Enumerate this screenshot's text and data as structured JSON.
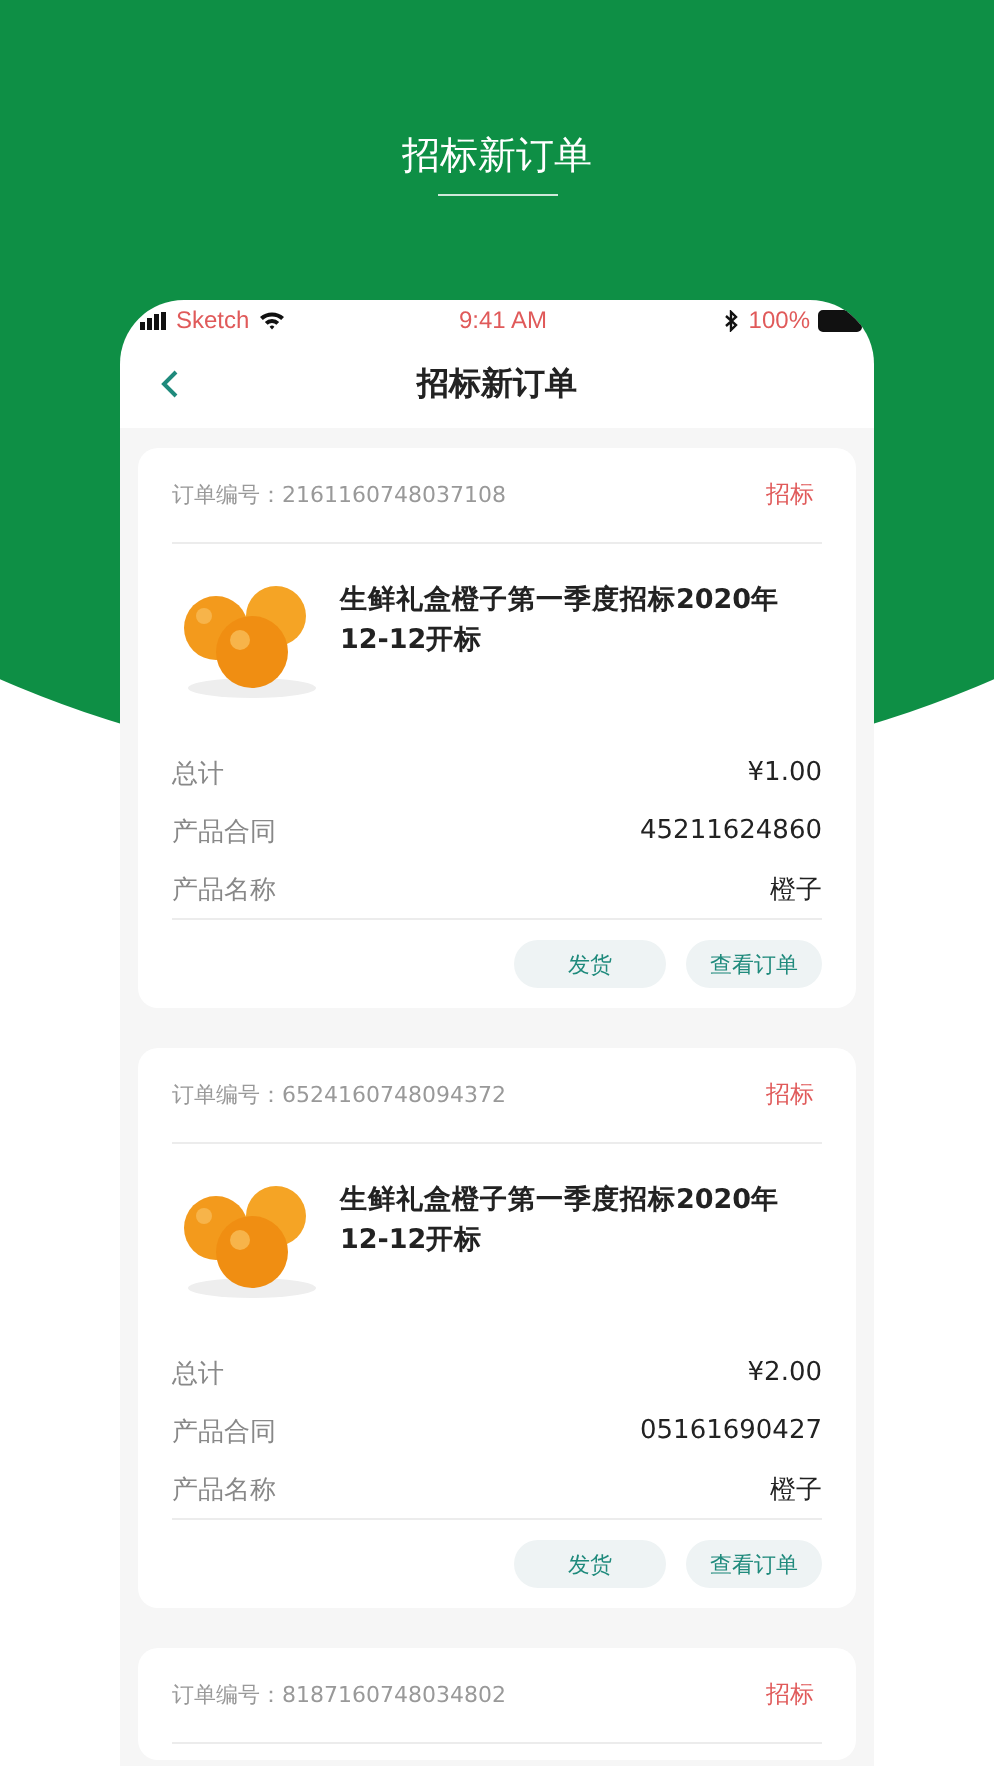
{
  "headline": "招标新订单",
  "status_bar": {
    "carrier": "Sketch",
    "time": "9:41 AM",
    "battery": "100%"
  },
  "nav": {
    "title": "招标新订单"
  },
  "orders": [
    {
      "number": "订单编号：2161160748037108",
      "status": "招标",
      "product": {
        "title": "生鲜礼盒橙子第一季度招标2020年12-12开标"
      },
      "details": [
        {
          "label": "总计",
          "value": "¥1.00"
        },
        {
          "label": "产品合同",
          "value": "45211624860"
        },
        {
          "label": "产品名称",
          "value": "橙子"
        }
      ],
      "actions": [
        "发货",
        "查看订单"
      ]
    },
    {
      "number": "订单编号：6524160748094372",
      "status": "招标",
      "product": {
        "title": "生鲜礼盒橙子第一季度招标2020年12-12开标"
      },
      "details": [
        {
          "label": "总计",
          "value": "¥2.00"
        },
        {
          "label": "产品合同",
          "value": "05161690427"
        },
        {
          "label": "产品名称",
          "value": "橙子"
        }
      ],
      "actions": [
        "发货",
        "查看订单"
      ]
    },
    {
      "number": "订单编号：8187160748034802",
      "status": "招标"
    }
  ]
}
